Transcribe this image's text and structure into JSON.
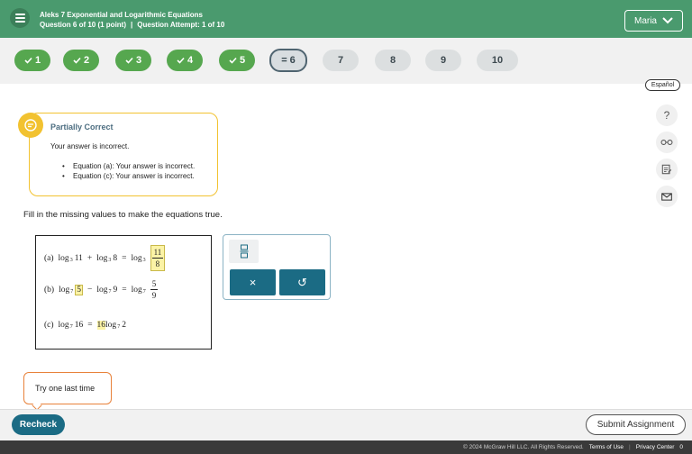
{
  "header": {
    "title": "Aleks 7 Exponential and Logarithmic Equations",
    "question_info": "Question 6 of 10 (1 point)",
    "separator": "|",
    "attempt_info": "Question Attempt: 1 of 10",
    "user_name": "Maria",
    "bg_color": "#4a9a6e"
  },
  "question_nav": [
    {
      "label": "1",
      "status": "correct"
    },
    {
      "label": "2",
      "status": "correct"
    },
    {
      "label": "3",
      "status": "correct"
    },
    {
      "label": "4",
      "status": "correct"
    },
    {
      "label": "5",
      "status": "correct"
    },
    {
      "label": "6",
      "status": "partial",
      "prefix": "="
    },
    {
      "label": "7",
      "status": "unanswered"
    },
    {
      "label": "8",
      "status": "unanswered"
    },
    {
      "label": "9",
      "status": "unanswered"
    },
    {
      "label": "10",
      "status": "unanswered"
    }
  ],
  "language_toggle": "Español",
  "feedback": {
    "title": "Partially Correct",
    "message": "Your answer is incorrect.",
    "items": [
      "Equation (a): Your answer is incorrect.",
      "Equation (c): Your answer is incorrect."
    ],
    "accent_color": "#f2c230"
  },
  "instruction": "Fill in the missing values to make the equations true.",
  "equations": {
    "a": {
      "label": "(a)",
      "t1": "log",
      "b1": "3",
      "v1": "11",
      "op": "+",
      "t2": "log",
      "b2": "3",
      "v2": "8",
      "eq": "=",
      "t3": "log",
      "b3": "3",
      "num": "11",
      "den": "8"
    },
    "b": {
      "label": "(b)",
      "t1": "log",
      "b1": "7",
      "v1": "5",
      "op": "−",
      "t2": "log",
      "b2": "7",
      "v2": "9",
      "eq": "=",
      "t3": "log",
      "b3": "7",
      "num": "5",
      "den": "9"
    },
    "c": {
      "label": "(c)",
      "t1": "log",
      "b1": "7",
      "v1": "16",
      "eq": "=",
      "coef": "16",
      "t2": "log",
      "b2": "7",
      "v2": "2"
    }
  },
  "palette": {
    "fraction_icon": "fraction-icon",
    "clear_icon": "×",
    "undo_icon": "↺"
  },
  "tools": [
    "help-icon",
    "glasses-icon",
    "notes-icon",
    "mail-icon"
  ],
  "tools_help_label": "?",
  "tooltip": "Try one last time",
  "buttons": {
    "recheck": "Recheck",
    "submit": "Submit Assignment"
  },
  "footer": {
    "copyright": "© 2024 McGraw Hill LLC. All Rights Reserved.",
    "terms": "Terms of Use",
    "privacy": "Privacy Center",
    "separator": "|",
    "trailing": "0"
  }
}
